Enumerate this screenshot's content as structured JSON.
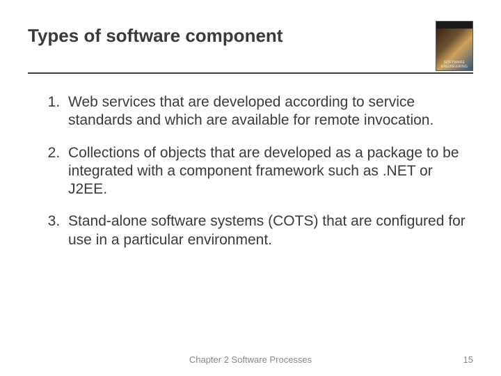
{
  "title": "Types of software component",
  "items": [
    "Web services that are developed according to service standards and which are available for remote invocation.",
    "Collections of objects that are developed as a package to be integrated with a component framework such as .NET or J2EE.",
    "Stand-alone software systems (COTS) that are configured for use in a particular environment."
  ],
  "footer": "Chapter 2 Software Processes",
  "page": "15"
}
